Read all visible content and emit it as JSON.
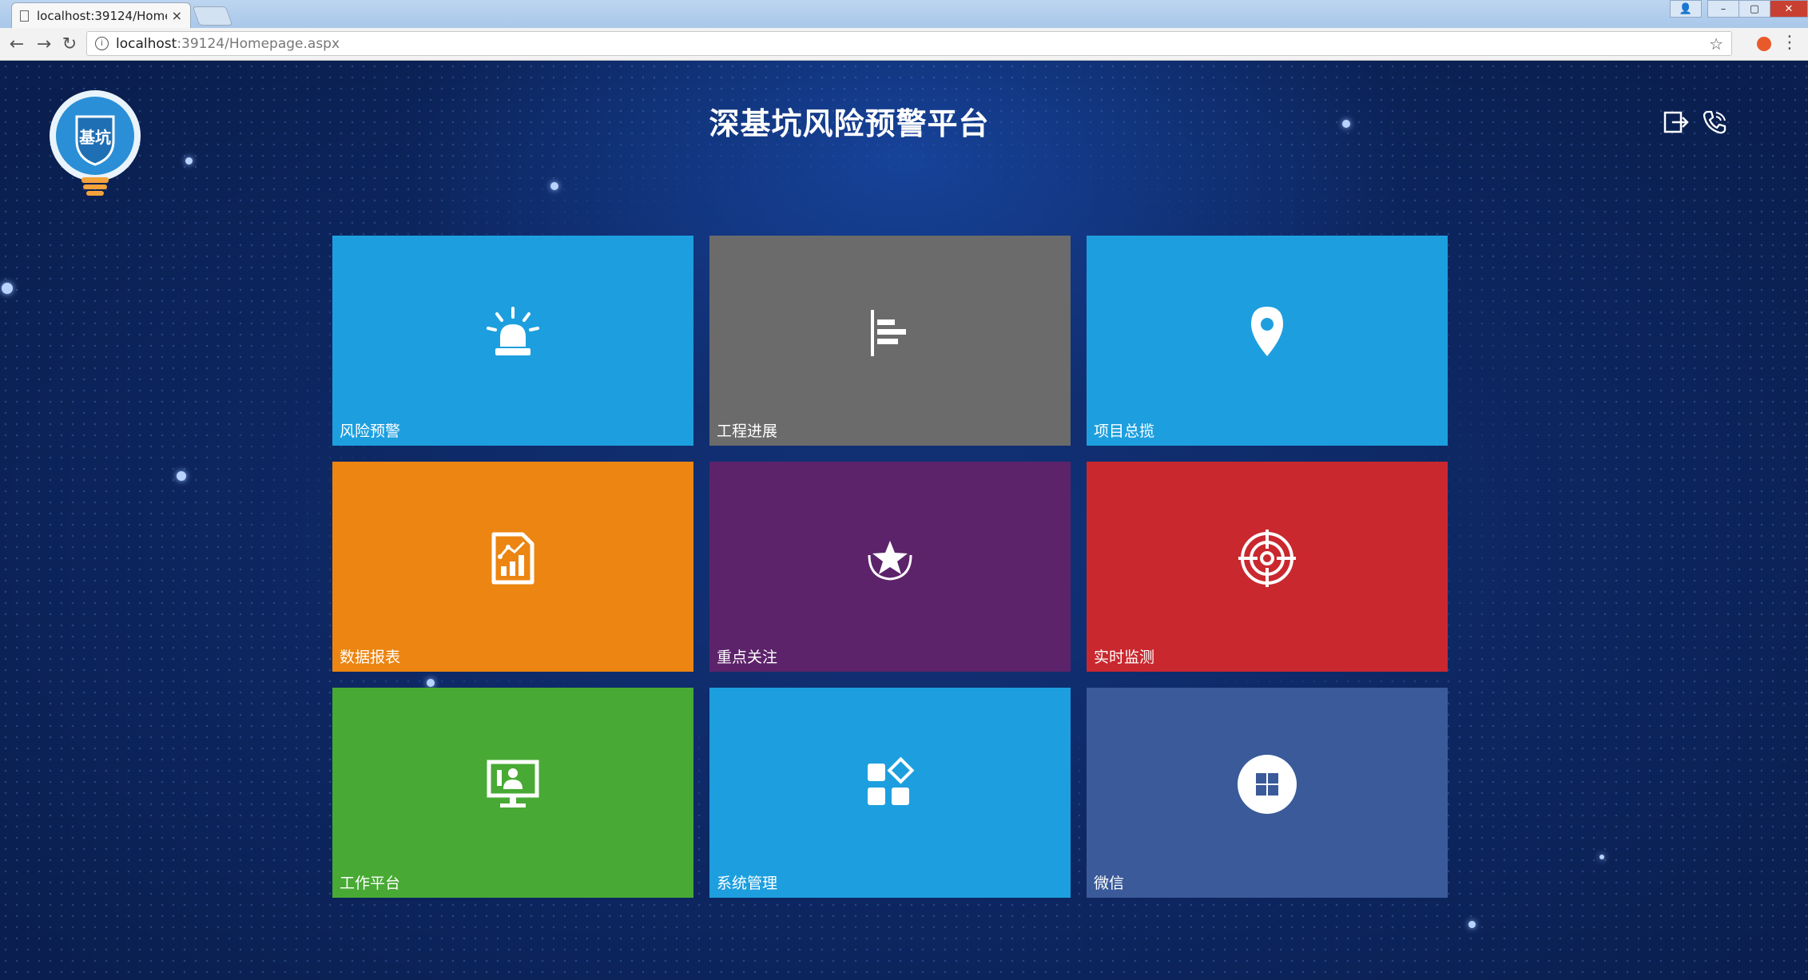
{
  "browser": {
    "tab_title": "localhost:39124/Home",
    "tab_close": "×",
    "url_host": "localhost",
    "url_path": ":39124/Homepage.aspx",
    "back": "←",
    "forward": "→",
    "reload": "↻",
    "star": "☆",
    "menu": "⋮",
    "info": "i",
    "win_user": "👤",
    "win_min": "–",
    "win_max": "▢",
    "win_close": "✕"
  },
  "header": {
    "title": "深基坑风险预警平台",
    "logo_text": "基坑",
    "icons": [
      "exit-icon",
      "phone-icon"
    ]
  },
  "tiles": [
    {
      "label": "风险预警",
      "icon": "alarm-light-icon",
      "color": "#1d9fdf"
    },
    {
      "label": "工程进展",
      "icon": "bar-progress-icon",
      "color": "#6b6b6b"
    },
    {
      "label": "项目总揽",
      "icon": "map-pin-icon",
      "color": "#1d9fdf"
    },
    {
      "label": "数据报表",
      "icon": "report-chart-icon",
      "color": "#ec8512"
    },
    {
      "label": "重点关注",
      "icon": "star-focus-icon",
      "color": "#5c236a"
    },
    {
      "label": "实时监测",
      "icon": "target-icon",
      "color": "#c9282e"
    },
    {
      "label": "工作平台",
      "icon": "monitor-user-icon",
      "color": "#48aa34"
    },
    {
      "label": "系统管理",
      "icon": "apps-grid-icon",
      "color": "#1d9fdf"
    },
    {
      "label": "微信",
      "icon": "windows-circle-icon",
      "color": "#3a5a9a"
    }
  ]
}
